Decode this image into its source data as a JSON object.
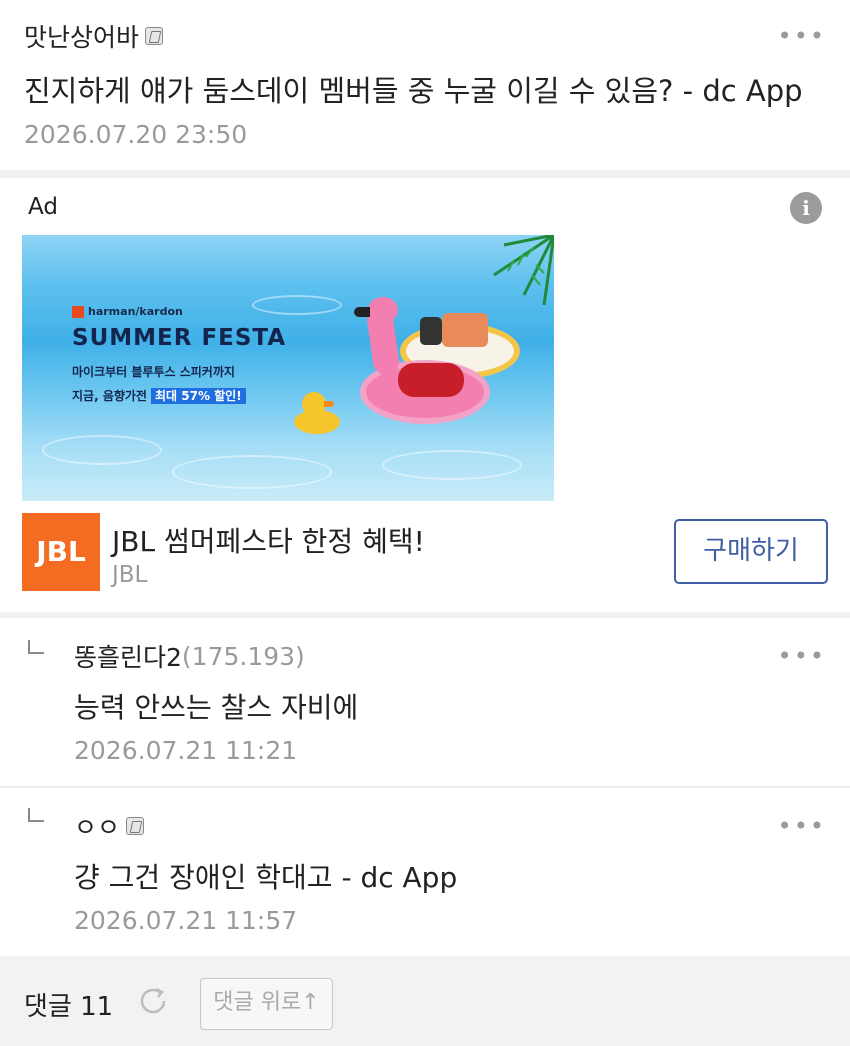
{
  "post": {
    "author": "맛난상어바",
    "more_label": "•••",
    "title": "진지하게 얘가 둠스데이 멤버들 중 누굴 이길 수 있음? - dc App",
    "date": "2026.07.20 23:50"
  },
  "ad": {
    "label": "Ad",
    "info_icon": "i",
    "banner": {
      "brand_small": "harman/kardon",
      "headline": "SUMMER FESTA",
      "line1": "마이크부터 블루투스 스피커까지",
      "line2_prefix": "지금, 음향가전",
      "line2_highlight": "최대 57% 할인!"
    },
    "logo_text": "JBL",
    "title": "JBL 썸머페스타 한정 혜택!",
    "brand": "JBL",
    "button_label": "구매하기"
  },
  "comments": [
    {
      "name": "똥흘린다2",
      "ip": "(175.193)",
      "text": "능력 안쓰는 찰스 자비에",
      "date": "2026.07.21 11:21",
      "more_label": "•••"
    },
    {
      "name": "ㅇㅇ",
      "text": "걍 그건 장애인 학대고 - dc App",
      "date": "2026.07.21 11:57",
      "more_label": "•••"
    }
  ],
  "bottom": {
    "comment_count": "댓글 11",
    "top_button": "댓글 위로↑"
  }
}
